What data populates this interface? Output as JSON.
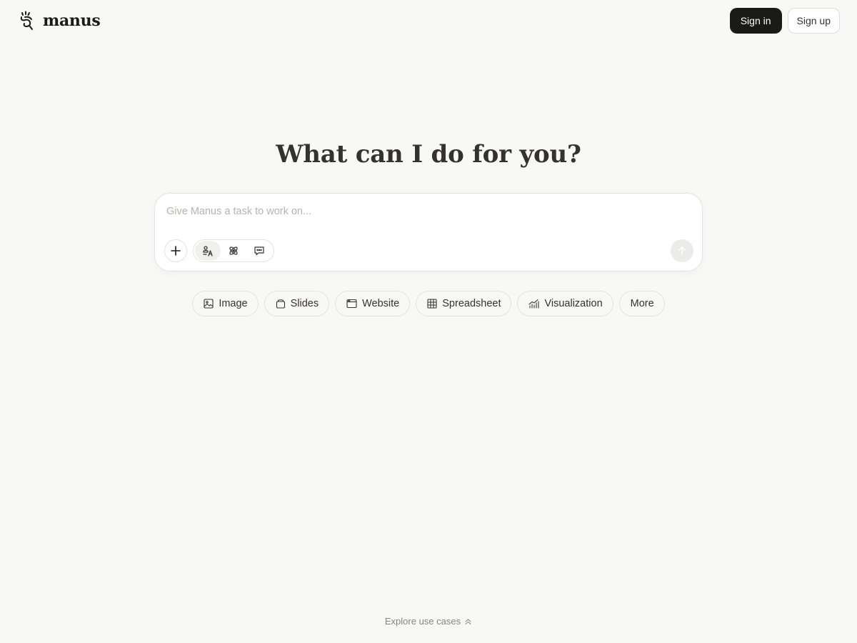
{
  "header": {
    "brand": "manus",
    "sign_in_label": "Sign in",
    "sign_up_label": "Sign up"
  },
  "main": {
    "heading": "What can I do for you?",
    "composer": {
      "placeholder": "Give Manus a task to work on...",
      "value": "",
      "icons": {
        "add": "plus-icon",
        "modes": [
          "agent-icon",
          "atom-icon",
          "chat-icon"
        ],
        "active_mode_index": 0,
        "send": "arrow-up-icon"
      }
    },
    "chips": [
      {
        "label": "Image",
        "icon": "image-icon"
      },
      {
        "label": "Slides",
        "icon": "slides-icon"
      },
      {
        "label": "Website",
        "icon": "browser-icon"
      },
      {
        "label": "Spreadsheet",
        "icon": "table-icon"
      },
      {
        "label": "Visualization",
        "icon": "chart-icon"
      },
      {
        "label": "More",
        "icon": ""
      }
    ]
  },
  "footer": {
    "explore_label": "Explore use cases",
    "explore_icon": "chevrons-up-icon"
  },
  "colors": {
    "background": "#f8f8f7",
    "primary_button": "#1a1a19",
    "text": "#34322d",
    "placeholder": "#b5b4b0",
    "muted": "#858481"
  }
}
